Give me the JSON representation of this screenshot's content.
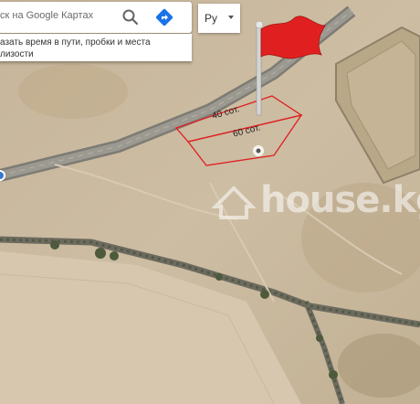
{
  "search": {
    "placeholder": "ск на Google Картах",
    "search_icon": "search-icon",
    "directions_icon": "directions-icon"
  },
  "suggestion": {
    "text": "азать время в пути, пробки и места\nлизости"
  },
  "language": {
    "selected": "Ру"
  },
  "plots": [
    {
      "label": "40 сот."
    },
    {
      "label": "60 сот."
    }
  ],
  "markers": {
    "flag_color": "#e02020",
    "pin_icon": "location-pin-icon"
  },
  "watermark": {
    "text": "house.kg",
    "icon": "house-logo-icon"
  },
  "colors": {
    "terrain": "#c9b79c",
    "road": "#8f8d86",
    "plot_outline": "#e02020"
  }
}
